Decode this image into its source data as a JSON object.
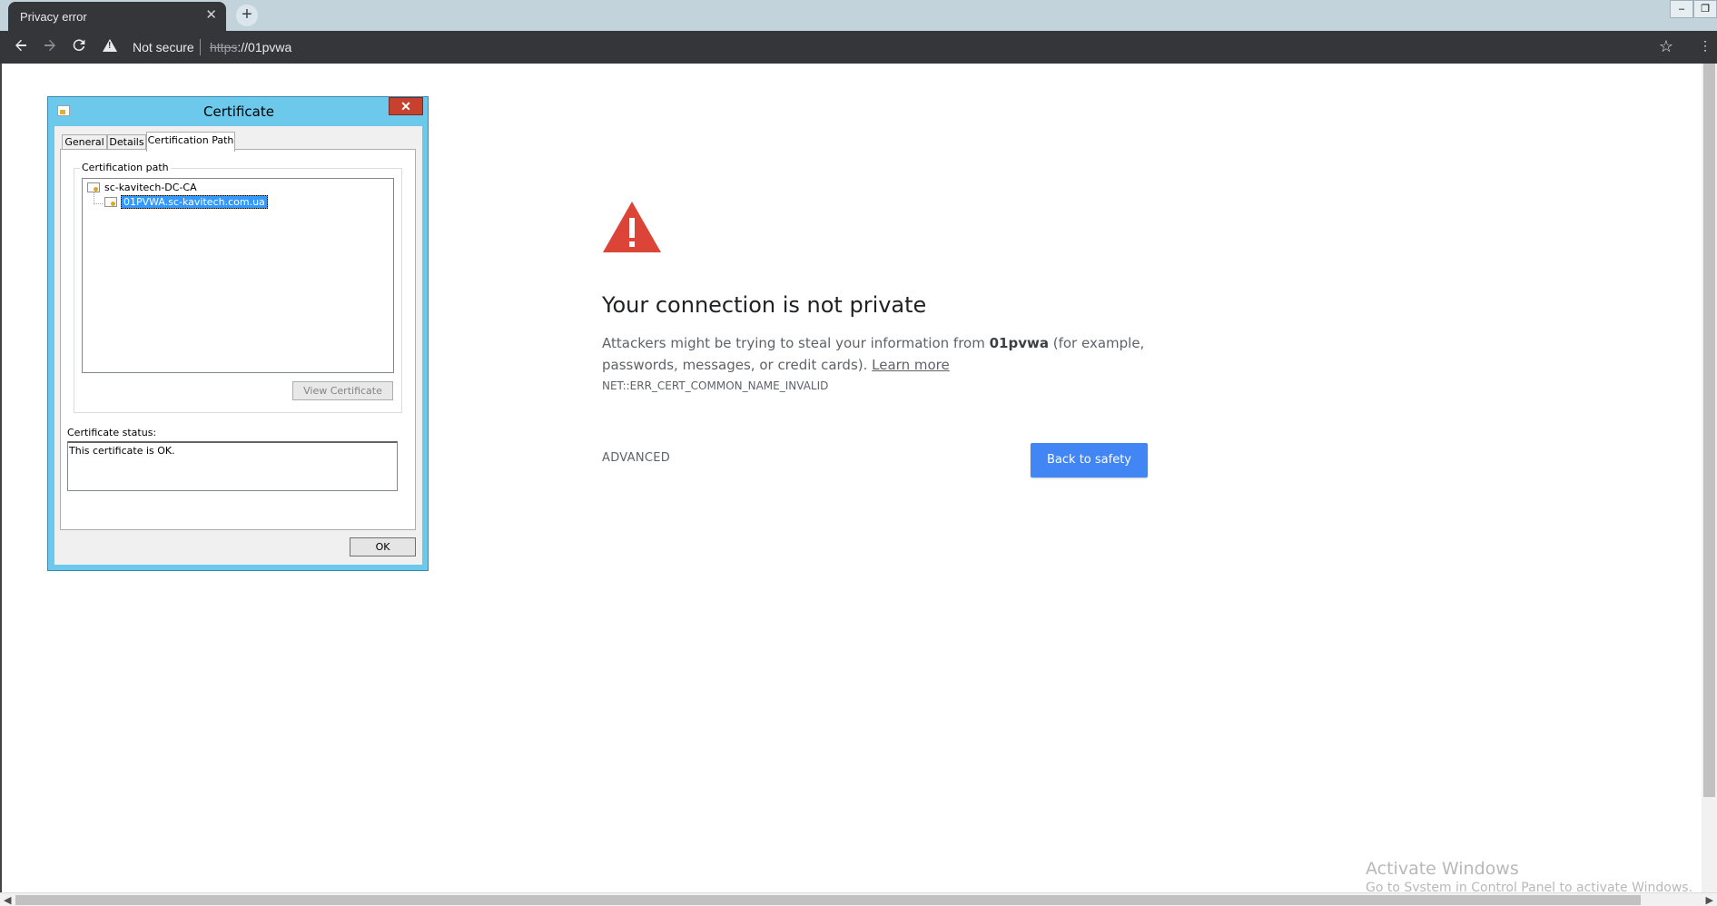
{
  "browser": {
    "tab_title": "Privacy error",
    "tab_close": "✕",
    "new_tab": "+",
    "window_controls": [
      "‒",
      "❐"
    ],
    "security_label": "Not secure",
    "url_scheme": "https",
    "url_rest": "://01pvwa",
    "icons": [
      "back-icon",
      "forward-icon",
      "reload-icon",
      "warning-icon",
      "star-icon"
    ]
  },
  "error_page": {
    "title": "Your connection is not private",
    "body_before": "Attackers might be trying to steal your information from ",
    "host": "01pvwa",
    "body_after": " (for example, passwords, messages, or credit cards). ",
    "learn_more": "Learn more",
    "error_code": "NET::ERR_CERT_COMMON_NAME_INVALID",
    "advanced_label": "ADVANCED",
    "back_label": "Back to safety",
    "icon_color": "#db4437",
    "button_color": "#4285f4"
  },
  "certificate_dialog": {
    "title": "Certificate",
    "close_label": "✕",
    "tabs": [
      {
        "label": "General",
        "active": false
      },
      {
        "label": "Details",
        "active": false
      },
      {
        "label": "Certification Path",
        "active": true
      }
    ],
    "path_group_label": "Certification path",
    "path_nodes": [
      {
        "label": "sc-kavitech-DC-CA",
        "selected": false
      },
      {
        "label": "01PVWA.sc-kavitech.com.ua",
        "selected": true
      }
    ],
    "view_certificate_label": "View Certificate",
    "status_label": "Certificate status:",
    "status_text": "This certificate is OK.",
    "ok_label": "OK"
  },
  "watermark": {
    "line1": "Activate Windows",
    "line2": "Go to System in Control Panel to activate Windows."
  }
}
